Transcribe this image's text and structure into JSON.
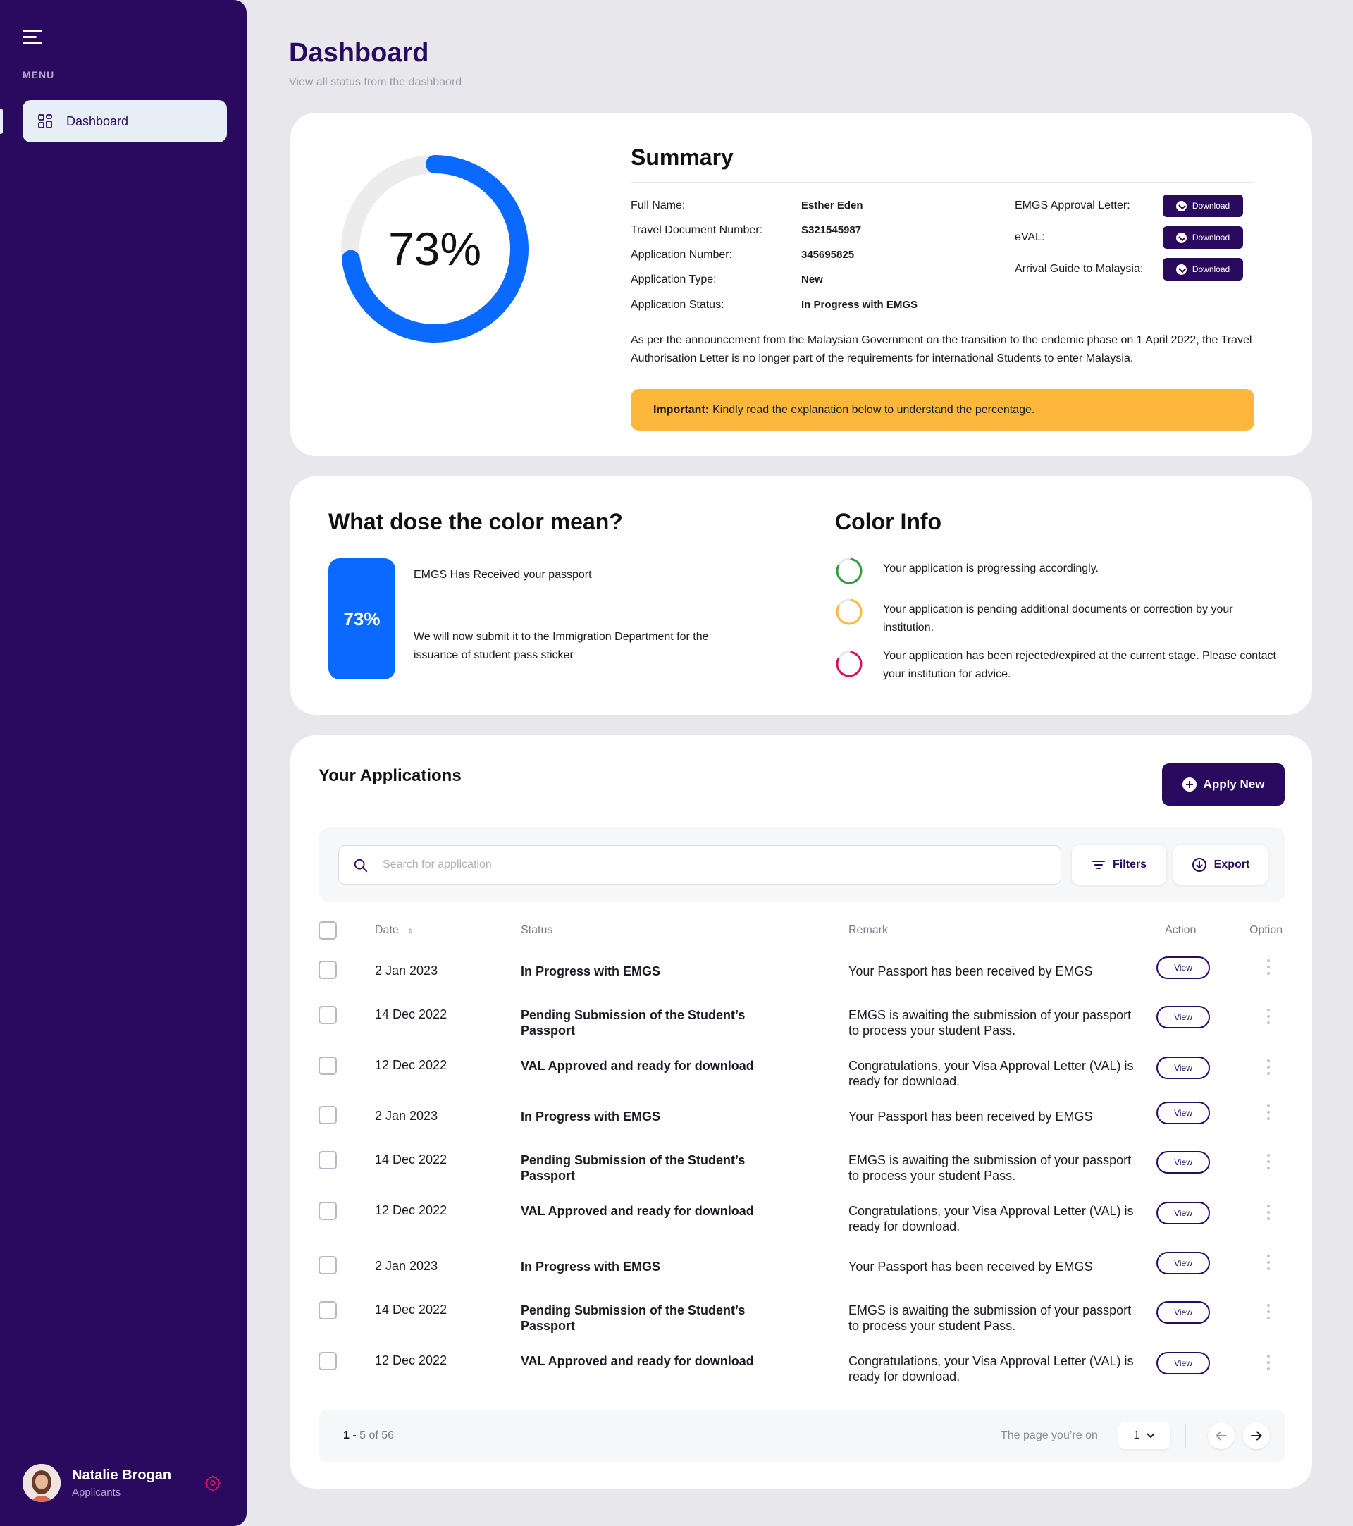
{
  "sidebar": {
    "menu_label": "MENU",
    "items": [
      {
        "label": "Dashboard",
        "icon": "grid-icon",
        "active": true
      }
    ],
    "profile": {
      "name": "Natalie Brogan",
      "role": "Applicants"
    }
  },
  "header": {
    "title": "Dashboard",
    "subtitle": "View all status from the dashbaord"
  },
  "summary": {
    "progress_percent": 73,
    "progress_text": "73%",
    "title": "Summary",
    "fields": [
      {
        "label": "Full Name:",
        "value": "Esther Eden"
      },
      {
        "label": "Travel Document Number:",
        "value": "S321545987"
      },
      {
        "label": "Application Number:",
        "value": "345695825"
      },
      {
        "label": "Application Type:",
        "value": "New"
      },
      {
        "label": "Application Status:",
        "value": "In Progress with EMGS"
      }
    ],
    "documents": [
      {
        "label": "EMGS Approval Letter:",
        "button": "Download"
      },
      {
        "label": "eVAL:",
        "button": "Download"
      },
      {
        "label": "Arrival Guide to Malaysia:",
        "button": "Download"
      }
    ],
    "notice": "As per the announcement from the Malaysian Government on the transition to the endemic phase on 1 April 2022, the Travel Authorisation Letter is no longer part of the requirements for international Students to enter Malaysia.",
    "important_label": "Important:",
    "important_text": "Kindly read the explanation below to understand the percentage."
  },
  "color_meaning": {
    "title": "What dose the color mean?",
    "percent_text": "73%",
    "line1": "EMGS Has Received your passport",
    "line2": "We will now submit it to the Immigration Department for the issuance of student pass sticker"
  },
  "color_info": {
    "title": "Color Info",
    "items": [
      {
        "color": "#2e9e3e",
        "text": "Your application is progressing accordingly."
      },
      {
        "color": "#fdb83c",
        "text": "Your application is pending additional documents or correction by your institution."
      },
      {
        "color": "#d4145a",
        "text": "Your application has been rejected/expired at the current stage. Please contact your institution for advice."
      }
    ]
  },
  "applications": {
    "title": "Your Applications",
    "apply_label": "Apply New",
    "search_placeholder": "Search for application",
    "filters_label": "Filters",
    "export_label": "Export",
    "columns": {
      "date": "Date",
      "status": "Status",
      "remark": "Remark",
      "action": "Action",
      "option": "Option"
    },
    "view_label": "View",
    "rows": [
      {
        "date": "2 Jan 2023",
        "status": "In Progress with EMGS",
        "remark": "Your Passport has been received by EMGS"
      },
      {
        "date": "14 Dec 2022",
        "status": "Pending Submission of the Student’s Passport",
        "remark": "EMGS is awaiting the submission of your passport to process your student Pass."
      },
      {
        "date": "12 Dec 2022",
        "status": "VAL Approved and ready for download",
        "remark": "Congratulations, your Visa Approval Letter (VAL) is ready for download."
      },
      {
        "date": "2 Jan 2023",
        "status": "In Progress with EMGS",
        "remark": "Your Passport has been received by EMGS"
      },
      {
        "date": "14 Dec 2022",
        "status": "Pending Submission of the Student’s Passport",
        "remark": "EMGS is awaiting the submission of your passport to process your student Pass."
      },
      {
        "date": "12 Dec 2022",
        "status": "VAL Approved and ready for download",
        "remark": "Congratulations, your Visa Approval Letter (VAL) is ready for download."
      },
      {
        "date": "2 Jan 2023",
        "status": "In Progress with EMGS",
        "remark": "Your Passport has been received by EMGS"
      },
      {
        "date": "14 Dec 2022",
        "status": "Pending Submission of the Student’s Passport",
        "remark": "EMGS is awaiting the submission of your passport to process your student Pass."
      },
      {
        "date": "12 Dec 2022",
        "status": "VAL Approved and ready for download",
        "remark": "Congratulations, your Visa Approval Letter (VAL) is ready for download."
      }
    ],
    "pagination": {
      "range_start": "1 -",
      "range_rest": "5 of 56",
      "page_label": "The page you’re on",
      "current_page": "1"
    }
  },
  "colors": {
    "sidebar_bg": "#2a0a5e",
    "primary": "#2a0a5e",
    "progress_blue": "#0a6aff",
    "warning": "#fdb83c"
  }
}
